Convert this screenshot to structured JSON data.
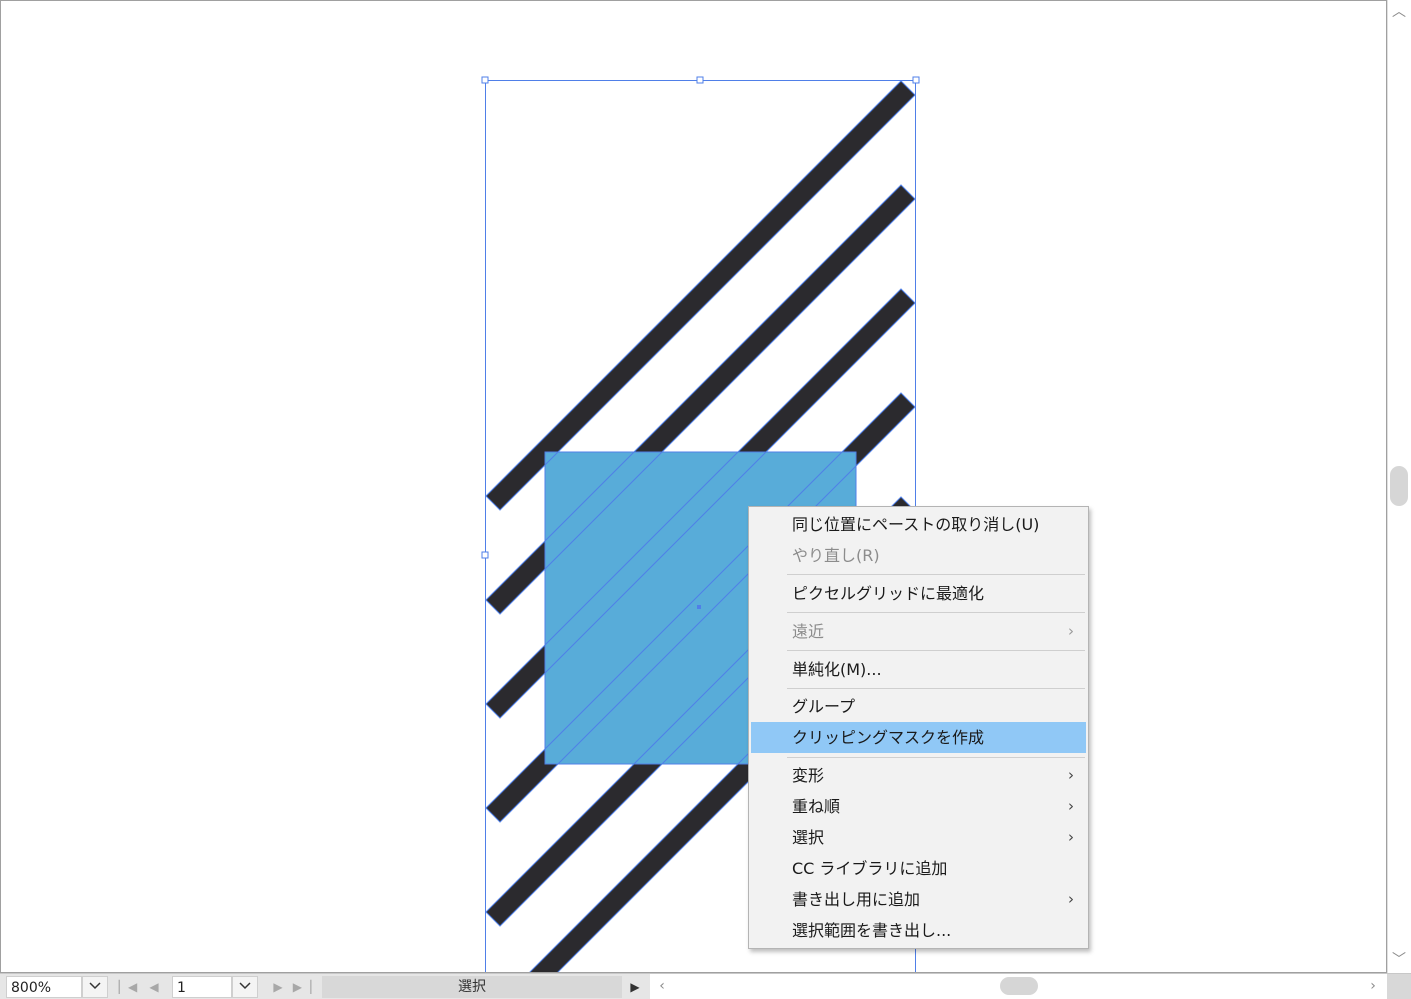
{
  "colors": {
    "selection_blue": "#4f7fe8",
    "fill_blue": "#58acd9",
    "stripe_dark": "#2b2a2e",
    "menu_highlight": "#90c8f6",
    "menu_bg": "#f2f2f2"
  },
  "context_menu": {
    "items": [
      {
        "label": "同じ位置にペーストの取り消し(U)",
        "enabled": true
      },
      {
        "label": "やり直し(R)",
        "enabled": false
      },
      {
        "label": "ピクセルグリッドに最適化",
        "enabled": true
      },
      {
        "label": "遠近",
        "enabled": false,
        "submenu": true
      },
      {
        "label": "単純化(M)...",
        "enabled": true
      },
      {
        "label": "グループ",
        "enabled": true
      },
      {
        "label": "クリッピングマスクを作成",
        "enabled": true,
        "highlighted": true
      },
      {
        "label": "変形",
        "enabled": true,
        "submenu": true
      },
      {
        "label": "重ね順",
        "enabled": true,
        "submenu": true
      },
      {
        "label": "選択",
        "enabled": true,
        "submenu": true
      },
      {
        "label": "CC ライブラリに追加",
        "enabled": true
      },
      {
        "label": "書き出し用に追加",
        "enabled": true,
        "submenu": true
      },
      {
        "label": "選択範囲を書き出し...",
        "enabled": true
      }
    ]
  },
  "status_bar": {
    "zoom": "800%",
    "artboard_number": "1",
    "tool_label": "選択"
  },
  "icons": {
    "dropdown": "chevron-down-icon",
    "first": "first-artboard-icon",
    "prev": "previous-artboard-icon",
    "next": "next-artboard-icon",
    "last": "last-artboard-icon",
    "status_menu": "play-triangle-icon",
    "submenu": "chevron-right-icon"
  }
}
